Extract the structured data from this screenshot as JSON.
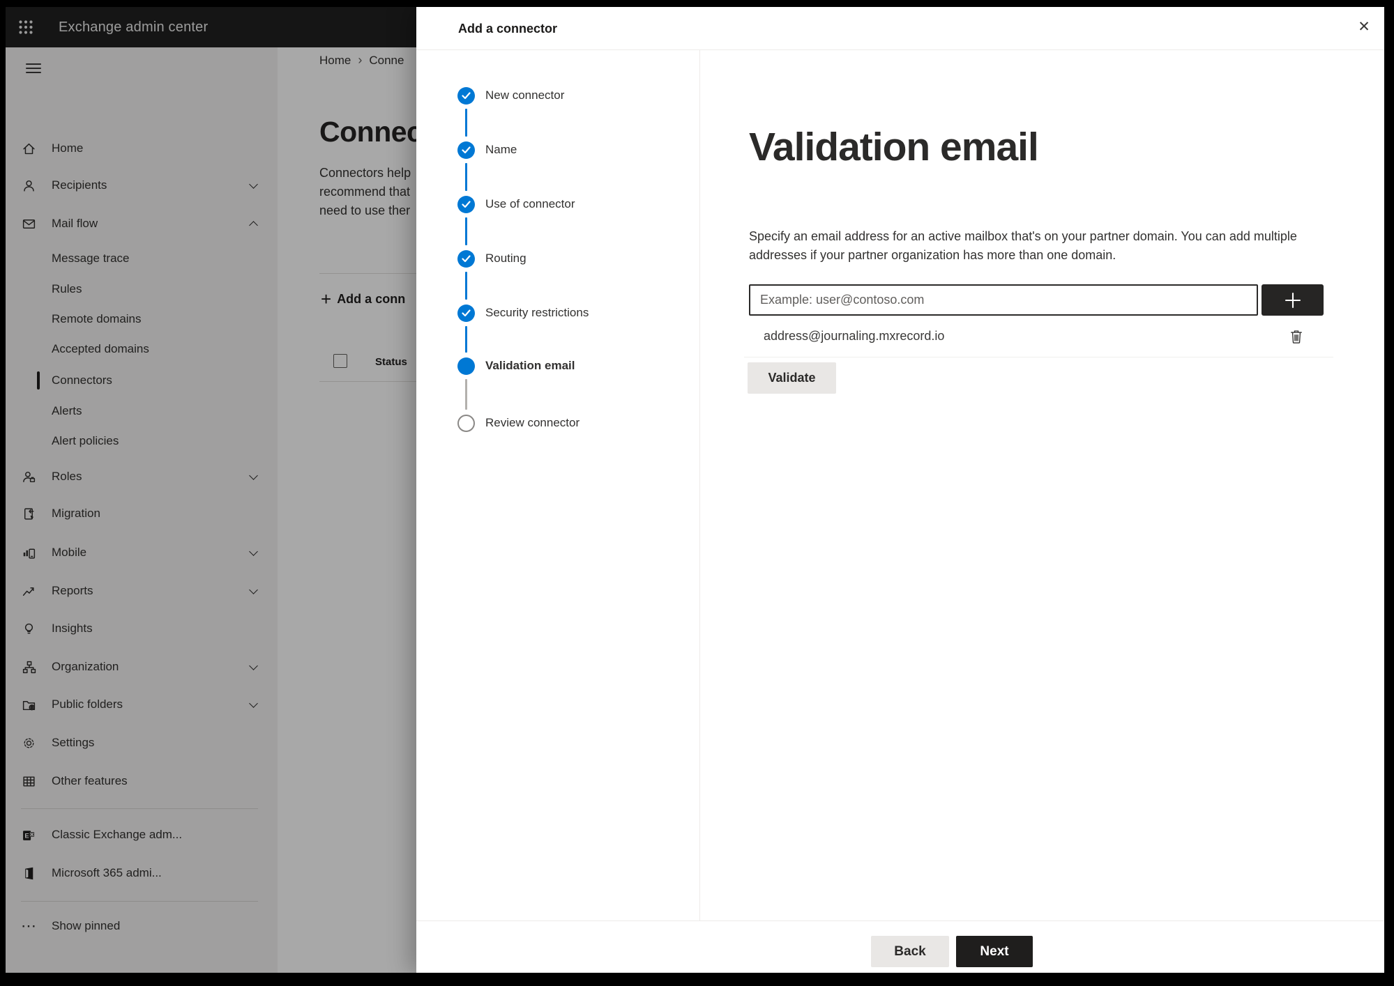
{
  "colors": {
    "accent_blue": "#0078d4",
    "dark_button": "#1f1e1d",
    "light_button": "#e9e7e5",
    "topbar": "#212120",
    "sidebar_bg": "#f3f2f1"
  },
  "icons": {
    "plus": "+",
    "close": "✕",
    "ellipsis": "⋯",
    "breadcrumb_separator": "›"
  },
  "header": {
    "app_title": "Exchange admin center"
  },
  "sidebar": {
    "items": [
      "Home",
      "Recipients",
      "Mail flow",
      "Roles",
      "Migration",
      "Mobile",
      "Reports",
      "Insights",
      "Organization",
      "Public folders",
      "Settings",
      "Other features"
    ],
    "mail_flow_items": [
      "Message trace",
      "Rules",
      "Remote domains",
      "Accepted domains",
      "Connectors",
      "Alerts",
      "Alert policies"
    ],
    "footer_items": [
      "Classic Exchange adm...",
      "Microsoft 365 admi...",
      "Show pinned"
    ]
  },
  "page": {
    "breadcrumb": [
      "Home",
      "Conne"
    ],
    "title": "Connect",
    "description_lines": [
      "Connectors help",
      "recommend that",
      "need to use ther"
    ],
    "add_button": "Add a conn",
    "status_column": "Status"
  },
  "panel": {
    "title": "Add a connector",
    "steps": [
      "New connector",
      "Name",
      "Use of connector",
      "Routing",
      "Security restrictions",
      "Validation email",
      "Review connector"
    ],
    "step_states": [
      "done",
      "done",
      "done",
      "done",
      "done",
      "current",
      "upcoming"
    ],
    "content": {
      "heading": "Validation email",
      "description": "Specify an email address for an active mailbox that's on your partner domain. You can add multiple addresses if your partner organization has more than one domain.",
      "email_placeholder": "Example: user@contoso.com",
      "added_address": "address@journaling.mxrecord.io",
      "validate_button": "Validate"
    },
    "footer": {
      "back_button": "Back",
      "next_button": "Next"
    }
  }
}
